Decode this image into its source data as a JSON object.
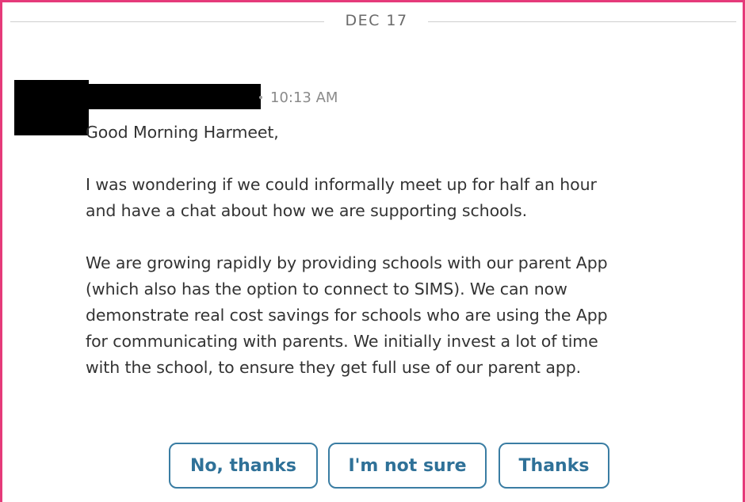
{
  "date_divider": "DEC 17",
  "message": {
    "timestamp": "10:13 AM",
    "greeting": "Good Morning Harmeet,",
    "paragraph1": [
      "I was wondering if we could informally meet up for half an hour",
      "and have a chat about how we are supporting schools."
    ],
    "paragraph2": [
      "We are growing rapidly by providing schools with our parent App",
      "(which also has the option to connect to SIMS). We can now",
      "demonstrate real cost savings for schools who are using the App",
      "for communicating with parents. We initially invest a lot of time",
      "with the school, to ensure they get full use of our parent app."
    ]
  },
  "quick_replies": {
    "no_thanks": "No, thanks",
    "not_sure": "I'm not sure",
    "thanks": "Thanks"
  },
  "colors": {
    "frame_border": "#e53a7a",
    "button_accent": "#2f7198",
    "redaction": "#000000"
  }
}
